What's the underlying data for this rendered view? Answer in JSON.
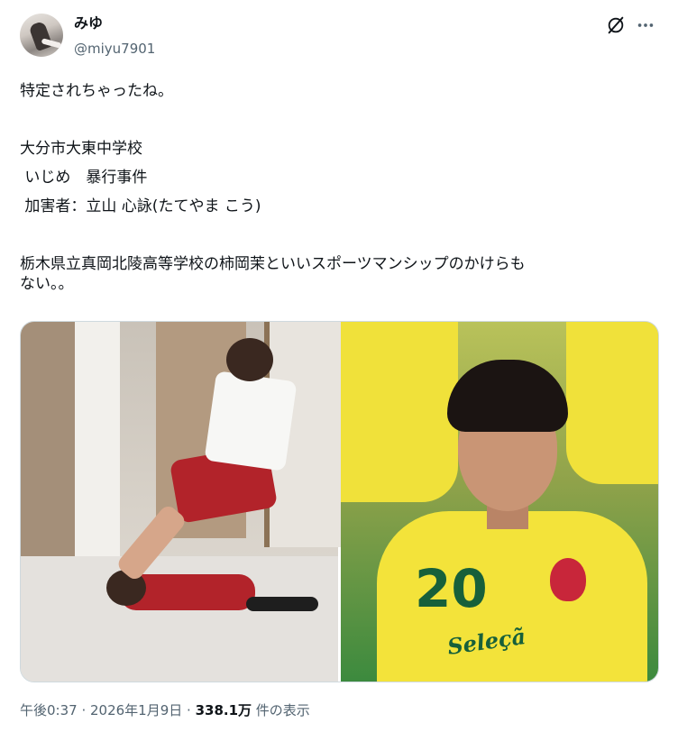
{
  "author": {
    "display_name": "みゆ",
    "handle": "@miyu7901"
  },
  "post": {
    "lines": [
      "特定されちゃったね。",
      "",
      "大分市大東中学校",
      " いじめ　暴行事件",
      " 加害者：立山 心詠(たてやま こう)",
      "",
      "栃木県立真岡北陵高等学校の柿岡茉といいスポーツマンシップのかけらも",
      "ない。。"
    ],
    "media": {
      "right_jersey_number": "20",
      "right_jersey_logo": "Seleçã"
    }
  },
  "footer": {
    "time": "午後0:37",
    "sep1": " · ",
    "date": "2026年1月9日",
    "sep2": " · ",
    "views": "338.1万",
    "views_suffix": " 件の表示"
  },
  "icons": {
    "grok": "grok-icon",
    "more": "more-icon"
  },
  "colors": {
    "text": "#0f1419",
    "muted": "#536471",
    "border": "#cfd9de"
  }
}
